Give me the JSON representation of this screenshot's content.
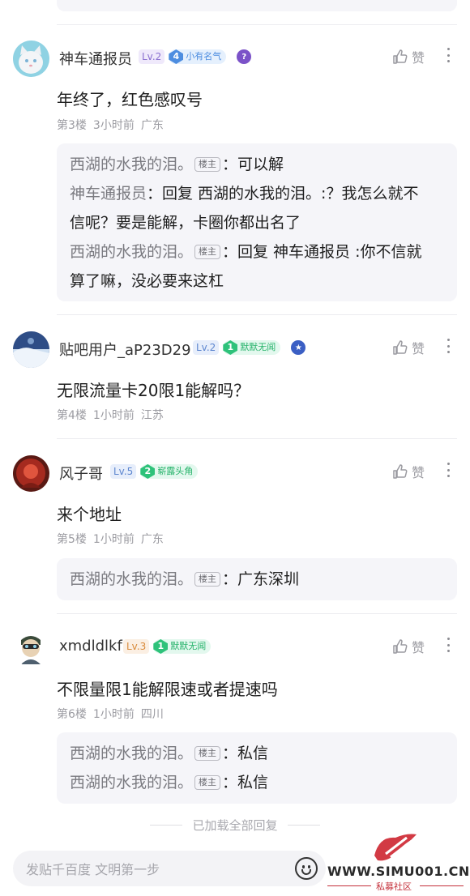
{
  "floors": [
    {
      "username": "神车通报员",
      "level": "Lv.2",
      "title_level": "4",
      "title_text": "小有名气",
      "content": "年终了，红色感叹号",
      "floor": "第3楼",
      "time": "3小时前",
      "location": "广东",
      "like_label": "赞",
      "replies": [
        {
          "name": "西湖的水我的泪。",
          "badge": "楼主",
          "text": "：可以解",
          "line2": ""
        },
        {
          "name": "神车通报员",
          "badge": "",
          "text": "：回复 西湖的水我的泪。:？我怎么就不",
          "line2": "信呢？要是能解，卡圈你都出名了"
        },
        {
          "name": "西湖的水我的泪。",
          "badge": "楼主",
          "text": "：回复 神车通报员 :你不信就",
          "line2": "算了嘛，没必要来这杠"
        }
      ]
    },
    {
      "username": "贴吧用户_aP23D29",
      "level": "Lv.2",
      "title_level": "1",
      "title_text": "默默无闻",
      "content": "无限流量卡20限1能解吗？",
      "floor": "第4楼",
      "time": "1小时前",
      "location": "江苏",
      "like_label": "赞"
    },
    {
      "username": "风子哥",
      "level": "Lv.5",
      "title_level": "2",
      "title_text": "崭露头角",
      "content": "来个地址",
      "floor": "第5楼",
      "time": "1小时前",
      "location": "广东",
      "like_label": "赞",
      "replies": [
        {
          "name": "西湖的水我的泪。",
          "badge": "楼主",
          "text": "：广东深圳"
        }
      ]
    },
    {
      "username": "xmdldlkf",
      "level": "Lv.3",
      "title_level": "1",
      "title_text": "默默无闻",
      "content": "不限量限1能解限速或者提速吗",
      "floor": "第6楼",
      "time": "1小时前",
      "location": "四川",
      "like_label": "赞",
      "replies": [
        {
          "name": "西湖的水我的泪。",
          "badge": "楼主",
          "text": "：私信"
        },
        {
          "name": "西湖的水我的泪。",
          "badge": "楼主",
          "text": "：私信"
        }
      ]
    }
  ],
  "loaded_all": "已加载全部回复",
  "input_placeholder": "发贴千百度 文明第一步",
  "watermark": {
    "url": "WWW.SIMU001.CN",
    "sub": "私募社区"
  },
  "icons": [
    "thumb-up-icon",
    "more-icon",
    "emoji-icon"
  ],
  "colors": {
    "reply_bg": "#f5f5f9",
    "green_badge": "#2ec27a",
    "blue_badge": "#4d8de0",
    "watermark_red": "#c4303a"
  }
}
